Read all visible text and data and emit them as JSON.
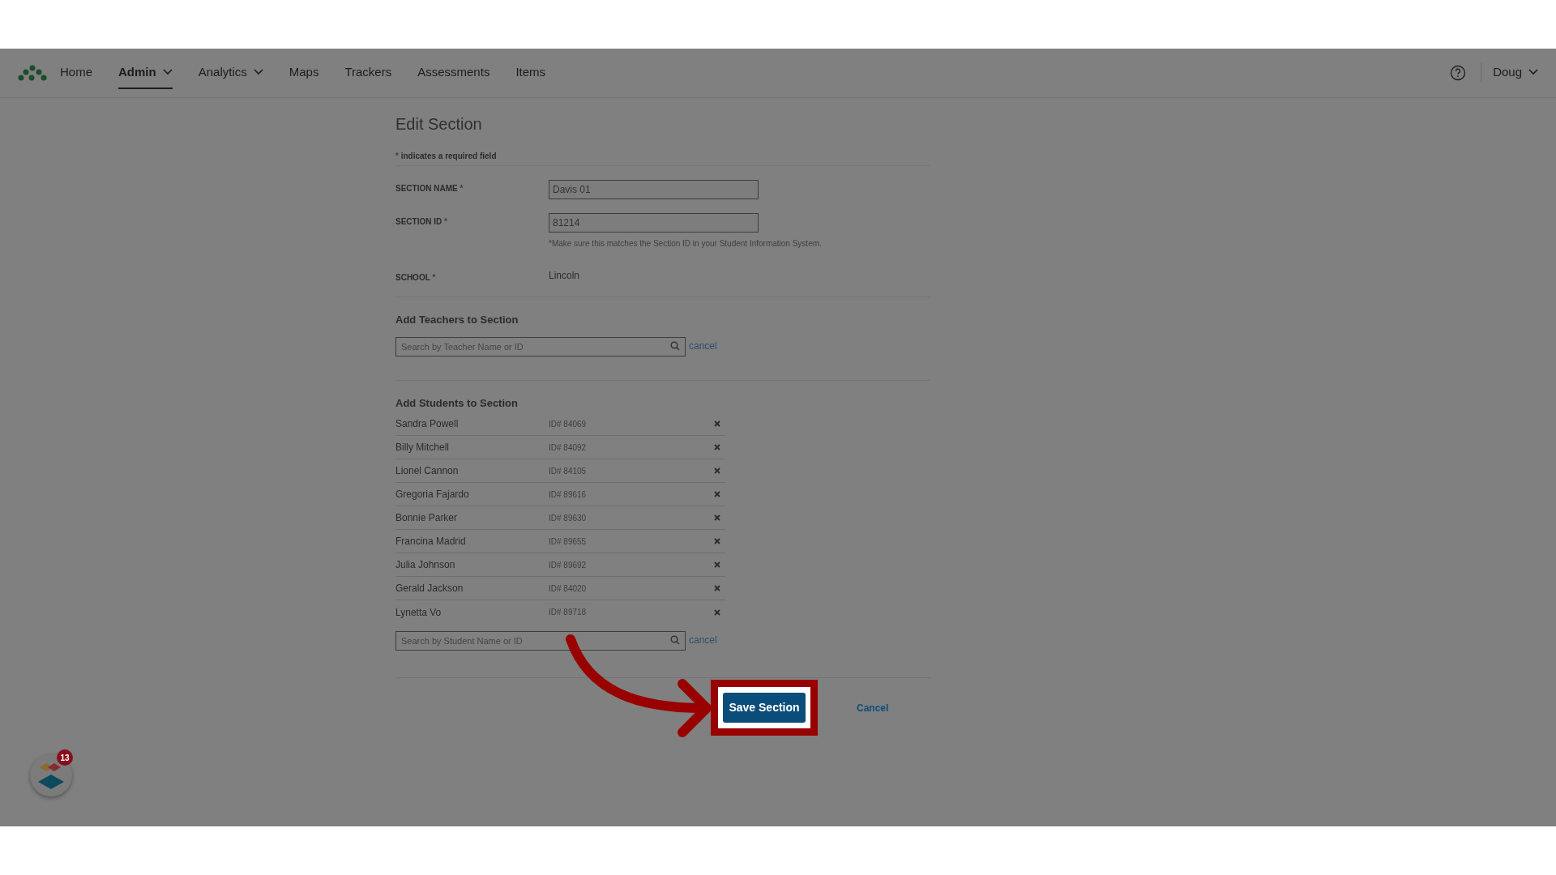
{
  "nav": {
    "items": [
      {
        "label": "Home",
        "dropdown": false,
        "selected": false
      },
      {
        "label": "Admin",
        "dropdown": true,
        "selected": true
      },
      {
        "label": "Analytics",
        "dropdown": true,
        "selected": false
      },
      {
        "label": "Maps",
        "dropdown": false,
        "selected": false
      },
      {
        "label": "Trackers",
        "dropdown": false,
        "selected": false
      },
      {
        "label": "Assessments",
        "dropdown": false,
        "selected": false
      },
      {
        "label": "Items",
        "dropdown": false,
        "selected": false
      }
    ],
    "user": "Doug"
  },
  "form": {
    "title": "Edit Section",
    "required_note": {
      "mark": "*",
      "text": "indicates a required field"
    },
    "fields": [
      {
        "kind": "input",
        "label": "SECTION NAME",
        "required": true,
        "value": "Davis 01"
      },
      {
        "kind": "input",
        "label": "SECTION ID",
        "required": true,
        "value": "81214",
        "hint": "*Make sure this matches the Section ID in your Student Information System."
      },
      {
        "kind": "static",
        "label": "SCHOOL",
        "required": true,
        "value": "Lincoln"
      }
    ]
  },
  "teachers": {
    "heading": "Add Teachers to Section",
    "search": {
      "placeholder": "Search by Teacher Name or ID"
    },
    "cancel": "cancel"
  },
  "students": {
    "heading": "Add Students to Section",
    "rows": [
      {
        "name": "Sandra Powell",
        "id": "ID# 84069"
      },
      {
        "name": "Billy Mitchell",
        "id": "ID# 84092"
      },
      {
        "name": "Lionel Cannon",
        "id": "ID# 84105"
      },
      {
        "name": "Gregoria Fajardo",
        "id": "ID# 89616"
      },
      {
        "name": "Bonnie Parker",
        "id": "ID# 89630"
      },
      {
        "name": "Francina Madrid",
        "id": "ID# 89655"
      },
      {
        "name": "Julia Johnson",
        "id": "ID# 89692"
      },
      {
        "name": "Gerald Jackson",
        "id": "ID# 84020"
      },
      {
        "name": "Lynetta Vo",
        "id": "ID# 89718"
      }
    ],
    "search": {
      "placeholder": "Search by Student Name or ID"
    },
    "cancel": "cancel"
  },
  "actions": {
    "save": "Save Section",
    "cancel": "Cancel"
  },
  "widget": {
    "badge": "13"
  }
}
